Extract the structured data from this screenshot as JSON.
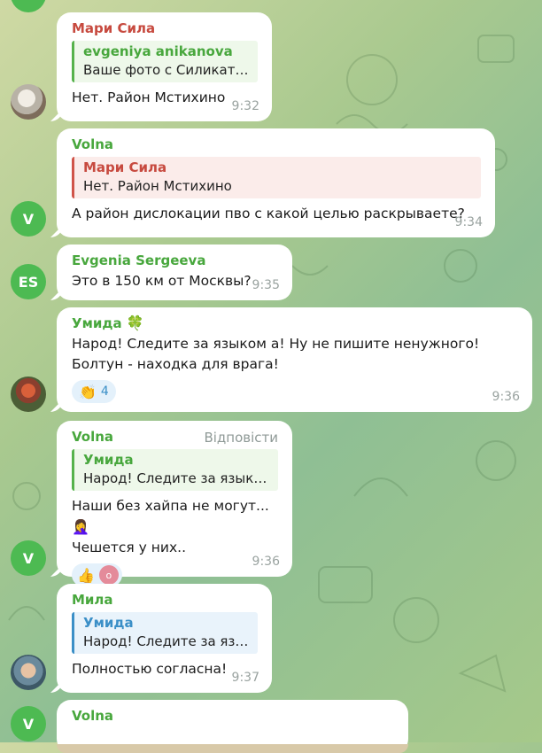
{
  "messages": [
    {
      "sender": "Мари Сила",
      "reply_name": "evgeniya anikanova",
      "reply_text": "Ваше фото с Силикатно...",
      "text": "Нет. Район Мстихино",
      "time": "9:32"
    },
    {
      "sender": "Volna",
      "avatar_letter": "V",
      "reply_name": "Мари Сила",
      "reply_text": "Нет. Район Мстихино",
      "text": "А район дислокации пво с какой целью раскрываете?",
      "time": "9:34"
    },
    {
      "sender": "Evgenia Sergeeva",
      "avatar_letter": "ES",
      "text": "Это в 150 км от Москвы?",
      "time": "9:35"
    },
    {
      "sender": "Умида",
      "sender_emoji": "🍀",
      "text": "Народ! Следите за языком а! Ну не пишите ненужного! Болтун - находка для врага!",
      "reaction_emoji": "👏",
      "reaction_count": "4",
      "time": "9:36"
    },
    {
      "sender": "Volna",
      "avatar_letter": "V",
      "reply_action": "Відповісти",
      "reply_name": "Умида",
      "reply_text": "Народ! Следите за языком ...",
      "text_line1": "Наши без хайпа не могут...",
      "text_emoji": "🤦‍♀️",
      "text_line2": "Чешется у них..",
      "reaction_emoji": "👍",
      "reaction_avatar": "o",
      "time": "9:36"
    },
    {
      "sender": "Мила",
      "reply_name": "Умида",
      "reply_text": "Народ! Следите за язык...",
      "text": "Полностью согласна!",
      "time": "9:37"
    },
    {
      "sender": "Volna",
      "avatar_letter": "V"
    }
  ]
}
